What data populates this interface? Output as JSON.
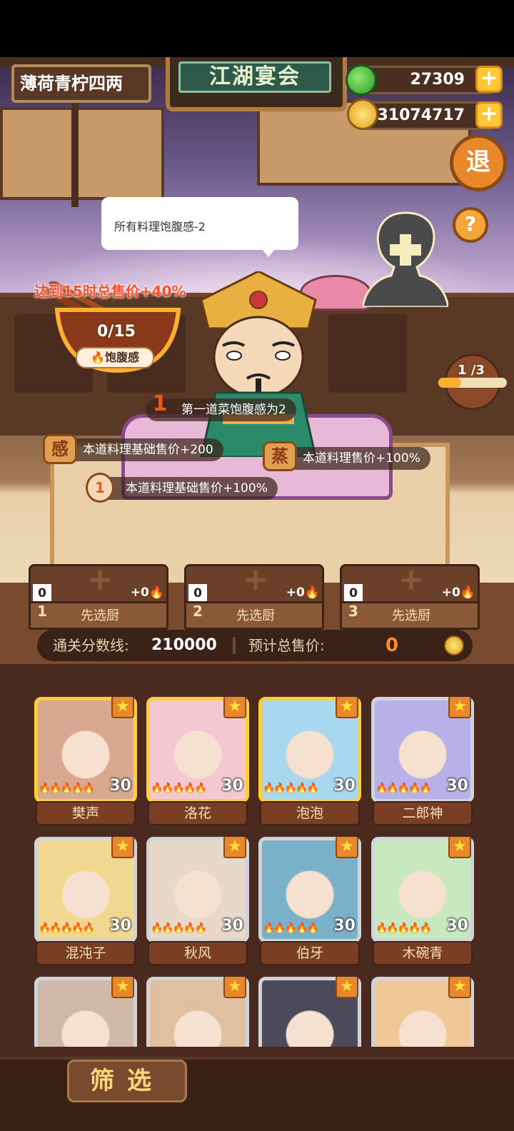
{
  "player": {
    "name": "薄荷青柠四两"
  },
  "sign": {
    "title": "江湖宴会"
  },
  "currency": {
    "gems": "27309",
    "coins": "31074717"
  },
  "buttons": {
    "exit": "退",
    "help": "?",
    "filter": "筛选",
    "plus": "+"
  },
  "speech": {
    "text": "所有料理饱腹感-2"
  },
  "satiety": {
    "goal_text": "达到15时总售价+40%",
    "count": "0/15",
    "label": "饱腹感"
  },
  "round": {
    "text": "1  /3"
  },
  "buffs": [
    {
      "badge": "1",
      "text": "第一道菜饱腹感为2"
    },
    {
      "badge": "感",
      "text": "本道料理基础售价+200"
    },
    {
      "badge": "蒸",
      "text": "本道料理售价+100%"
    },
    {
      "badge": "1",
      "text": "本道料理基础售价+100%"
    }
  ],
  "slots": [
    {
      "num": "1",
      "count": "0",
      "fire": "+0",
      "label": "先选厨"
    },
    {
      "num": "2",
      "count": "0",
      "fire": "+0",
      "label": "先选厨"
    },
    {
      "num": "3",
      "count": "0",
      "fire": "+0",
      "label": "先选厨"
    }
  ],
  "score": {
    "pass_label": "通关分数线:",
    "pass_value": "210000",
    "total_label": "预计总售价:",
    "total_value": "0"
  },
  "chefs": [
    {
      "name": "樊声",
      "level": "30",
      "frame": "gold",
      "bg": "#d8a890"
    },
    {
      "name": "洛花",
      "level": "30",
      "frame": "gold",
      "bg": "#f4c8d0"
    },
    {
      "name": "泡泡",
      "level": "30",
      "frame": "gold",
      "bg": "#a8d8f0"
    },
    {
      "name": "二郎神",
      "level": "30",
      "frame": "silver",
      "bg": "#b8b0e8"
    },
    {
      "name": "混沌子",
      "level": "30",
      "frame": "silver",
      "bg": "#f0d890"
    },
    {
      "name": "秋风",
      "level": "30",
      "frame": "silver",
      "bg": "#e8d8c8"
    },
    {
      "name": "伯牙",
      "level": "30",
      "frame": "silver",
      "bg": "#7ab0c8"
    },
    {
      "name": "木碗青",
      "level": "30",
      "frame": "silver",
      "bg": "#c8e8c0"
    },
    {
      "name": "",
      "level": "",
      "frame": "silver",
      "bg": "#d0b8a8"
    },
    {
      "name": "",
      "level": "",
      "frame": "silver",
      "bg": "#e0c0a0"
    },
    {
      "name": "",
      "level": "",
      "frame": "silver",
      "bg": "#4a4a5a"
    },
    {
      "name": "",
      "level": "",
      "frame": "silver",
      "bg": "#f0c898"
    }
  ],
  "colors": {
    "gold_frame": "#ffce3a",
    "silver_frame": "#cfd4da",
    "accent_red": "#ff4e2a",
    "plus_yellow": "#ffc832"
  }
}
